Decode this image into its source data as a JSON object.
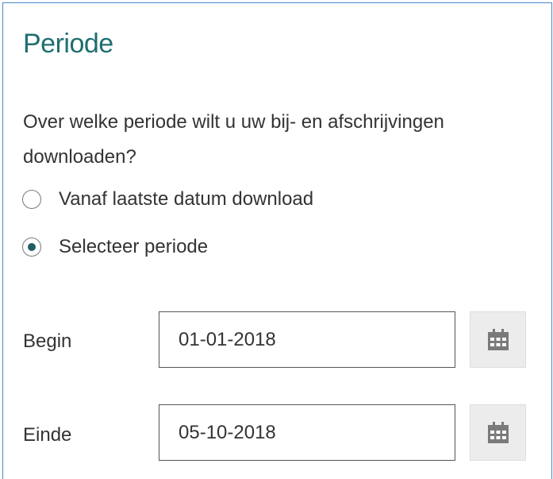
{
  "section": {
    "title": "Periode",
    "question": "Over welke periode wilt u uw bij- en afschrijvingen downloaden?"
  },
  "options": [
    {
      "label": "Vanaf laatste datum download",
      "selected": false
    },
    {
      "label": "Selecteer periode",
      "selected": true
    }
  ],
  "fields": {
    "begin": {
      "label": "Begin",
      "value": "01-01-2018",
      "button_icon": "calendar-icon"
    },
    "einde": {
      "label": "Einde",
      "value": "05-10-2018",
      "button_icon": "calendar-icon"
    }
  },
  "colors": {
    "accent": "#1f6e70",
    "border": "#4a8bc4",
    "icon": "#7a7a7a"
  }
}
